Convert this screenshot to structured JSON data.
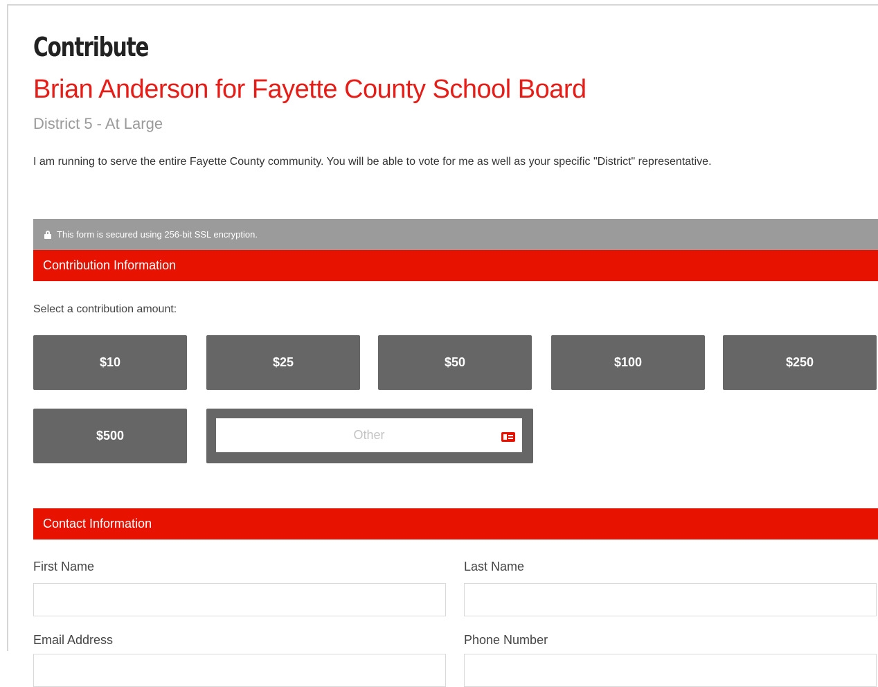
{
  "header": {
    "title": "Contribute",
    "campaign": "Brian Anderson for Fayette County School Board",
    "district": "District 5 - At Large",
    "description": "I am running to serve the entire Fayette County community. You will be able to vote for me as well as your specific \"District\" representative."
  },
  "security": {
    "icon": "lock-icon",
    "text": "This form is secured using 256-bit SSL encryption."
  },
  "contribution": {
    "section_title": "Contribution Information",
    "select_label": "Select a contribution amount:",
    "amounts": [
      "$10",
      "$25",
      "$50",
      "$100",
      "$250",
      "$500"
    ],
    "other": {
      "placeholder": "Other",
      "value": "",
      "icon": "credit-card-icon"
    }
  },
  "contact": {
    "section_title": "Contact Information",
    "first_name": {
      "label": "First Name",
      "value": ""
    },
    "last_name": {
      "label": "Last Name",
      "value": ""
    },
    "email": {
      "label": "Email Address",
      "value": ""
    },
    "phone": {
      "label": "Phone Number",
      "value": ""
    }
  },
  "colors": {
    "accent": "#e81200",
    "title_red": "#e81c16",
    "button_gray": "#666666",
    "secure_bar": "#9b9b9b"
  }
}
